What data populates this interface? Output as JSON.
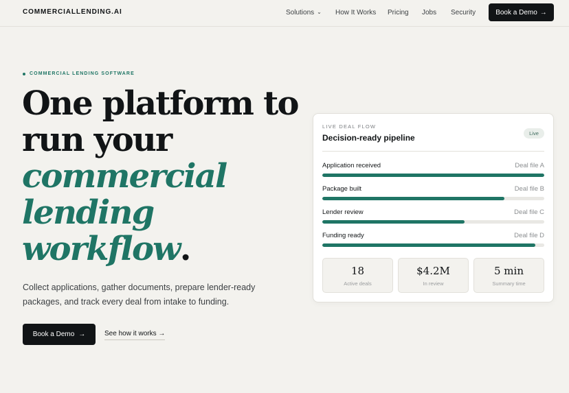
{
  "nav": {
    "brand": "COMMERCIALLENDING.AI",
    "links": [
      {
        "label": "Solutions",
        "has_dropdown": true
      },
      {
        "label": "How It Works"
      },
      {
        "label": "Pricing"
      },
      {
        "label": "Jobs"
      },
      {
        "label": "Security"
      }
    ],
    "cta_label": "Book a Demo"
  },
  "hero": {
    "eyebrow": "COMMERCIAL LENDING SOFTWARE",
    "headline": {
      "line1": "One platform to",
      "line2": "run your",
      "accent_line1": "commercial",
      "accent_line2": "lending",
      "accent_line3": "workflow",
      "period": "."
    },
    "subcopy": "Collect applications, gather documents, prepare lender-ready packages, and track every deal from intake to funding.",
    "primary_cta": "Book a Demo",
    "secondary_cta": "See how it works"
  },
  "card": {
    "eyebrow": "LIVE DEAL FLOW",
    "title": "Decision-ready pipeline",
    "badge": "Live",
    "stages": [
      {
        "label": "Application received",
        "file": "Deal file A",
        "progress": 1.0
      },
      {
        "label": "Package built",
        "file": "Deal file B",
        "progress": 0.82
      },
      {
        "label": "Lender review",
        "file": "Deal file C",
        "progress": 0.64
      },
      {
        "label": "Funding ready",
        "file": "Deal file D",
        "progress": 0.96
      }
    ],
    "stats": [
      {
        "value": "18",
        "label": "Active deals"
      },
      {
        "value": "$4.2M",
        "label": "In review"
      },
      {
        "value": "5 min",
        "label": "Summary time"
      }
    ]
  },
  "colors": {
    "accent": "#1f7565",
    "background": "#f3f2ee",
    "dark": "#111416"
  }
}
